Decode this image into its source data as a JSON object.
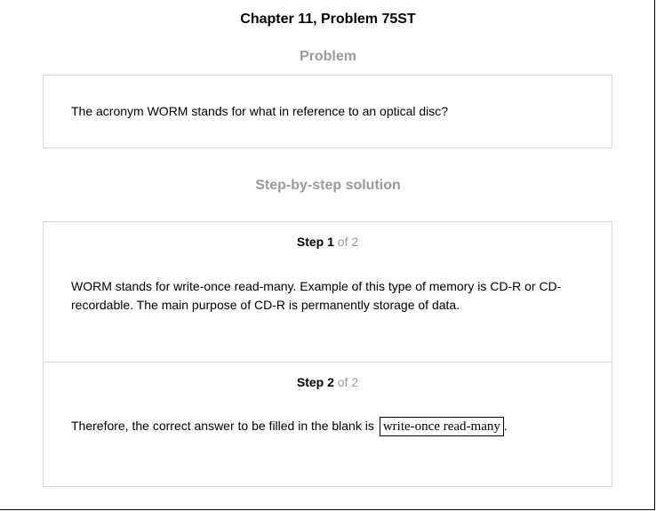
{
  "header": {
    "title": "Chapter 11, Problem 75ST"
  },
  "problem": {
    "heading": "Problem",
    "text": "The acronym WORM stands for what in reference to an optical disc?"
  },
  "solution": {
    "heading": "Step-by-step solution",
    "steps": [
      {
        "step_word": "Step",
        "number": "1",
        "of_text": "of 2",
        "text": "WORM stands for write-once read-many. Example of this type of memory is CD-R or CD-recordable. The main purpose of CD-R is permanently storage of data."
      },
      {
        "step_word": "Step",
        "number": "2",
        "of_text": "of 2",
        "text_before": "Therefore, the correct answer to be filled in the blank is",
        "answer": "write-once read-many",
        "text_after": "."
      }
    ]
  }
}
